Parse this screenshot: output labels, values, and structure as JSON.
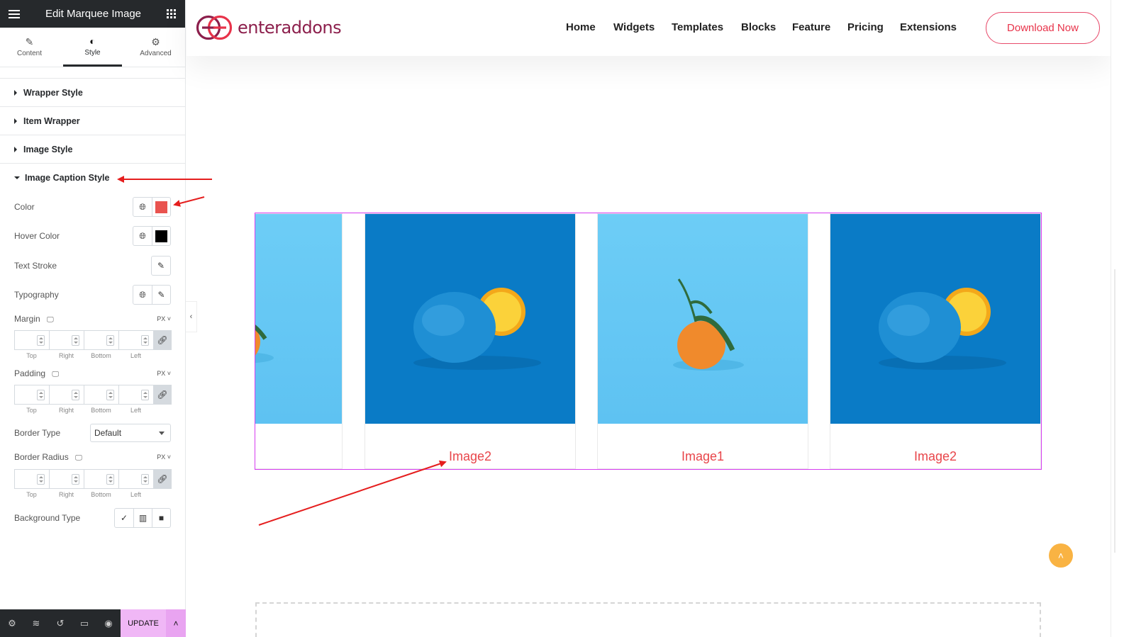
{
  "panel": {
    "title": "Edit Marquee Image",
    "tabs": [
      {
        "label": "Content",
        "icon": "pencil-icon"
      },
      {
        "label": "Style",
        "icon": "contrast-icon"
      },
      {
        "label": "Advanced",
        "icon": "gear-icon"
      }
    ],
    "sections": [
      {
        "label": "Wrapper Style"
      },
      {
        "label": "Item Wrapper"
      },
      {
        "label": "Image Style"
      },
      {
        "label": "Image Caption Style"
      }
    ],
    "controls": {
      "color": {
        "label": "Color",
        "value": "#e9534f"
      },
      "hover_color": {
        "label": "Hover Color",
        "value": "#000000"
      },
      "text_stroke": {
        "label": "Text Stroke"
      },
      "typography": {
        "label": "Typography"
      },
      "margin": {
        "label": "Margin",
        "unit": "PX"
      },
      "padding": {
        "label": "Padding",
        "unit": "PX"
      },
      "border_type": {
        "label": "Border Type",
        "value": "Default"
      },
      "border_radius": {
        "label": "Border Radius",
        "unit": "PX"
      },
      "background_type": {
        "label": "Background Type"
      },
      "dim_labels": [
        "Top",
        "Right",
        "Bottom",
        "Left"
      ]
    },
    "update_label": "UPDATE"
  },
  "site": {
    "logo_text": "enteraddons",
    "brand_color": "#8c1f4c",
    "nav": [
      "Home",
      "Widgets",
      "Templates",
      "Blocks",
      "Feature",
      "Pricing",
      "Extensions"
    ],
    "download_label": "Download Now",
    "accent": "#e8334a"
  },
  "marquee": {
    "items": [
      {
        "caption": "",
        "image": "orange-stem-icon",
        "bg": "light"
      },
      {
        "caption": "Image2",
        "image": "orange-half-icon",
        "bg": "dark"
      },
      {
        "caption": "Image1",
        "image": "orange-stem-icon",
        "bg": "light"
      },
      {
        "caption": "Image2",
        "image": "orange-half-icon",
        "bg": "dark"
      }
    ],
    "caption_color": "#e8454a"
  }
}
